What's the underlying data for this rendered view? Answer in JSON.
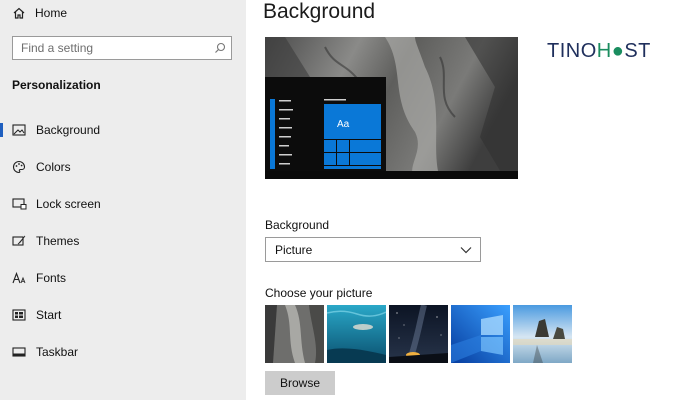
{
  "sidebar": {
    "home_label": "Home",
    "search": {
      "placeholder": "Find a setting"
    },
    "section_title": "Personalization",
    "items": [
      {
        "label": "Background",
        "icon": "picture-icon",
        "selected": true
      },
      {
        "label": "Colors",
        "icon": "palette-icon",
        "selected": false
      },
      {
        "label": "Lock screen",
        "icon": "lock-screen-icon",
        "selected": false
      },
      {
        "label": "Themes",
        "icon": "brush-icon",
        "selected": false
      },
      {
        "label": "Fonts",
        "icon": "font-icon",
        "selected": false
      },
      {
        "label": "Start",
        "icon": "start-icon",
        "selected": false
      },
      {
        "label": "Taskbar",
        "icon": "taskbar-icon",
        "selected": false
      }
    ]
  },
  "main": {
    "title": "Background",
    "preview": {
      "tile_label": "Aa"
    },
    "background_field": {
      "label": "Background",
      "value": "Picture"
    },
    "choose_label": "Choose your picture",
    "thumbnails": [
      "rock-wall",
      "underwater-swimmer",
      "night-sky-aurora",
      "windows-blue-light",
      "beach-rocks"
    ],
    "browse_label": "Browse"
  },
  "watermark": {
    "part1": "TINO",
    "part2": "H",
    "part3": "ST"
  },
  "colors": {
    "accent": "#0a78d7",
    "sidebar_bg": "#ededed",
    "selection_bar": "#1f5fbf"
  }
}
